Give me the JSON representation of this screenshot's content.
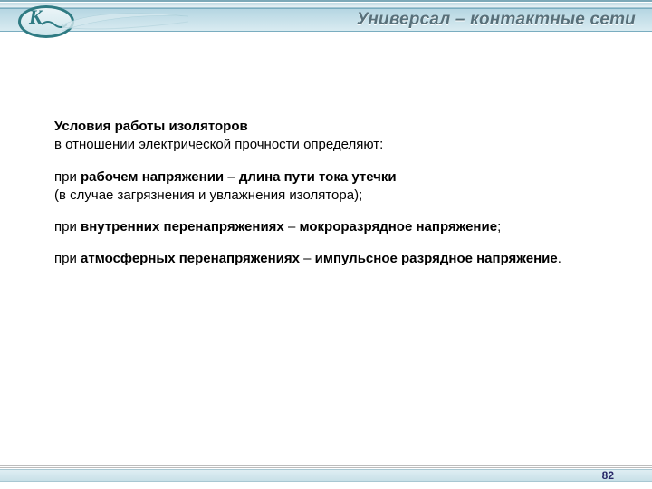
{
  "header": {
    "title": "Универсал – контактные сети",
    "logo_letter": "К"
  },
  "content": {
    "intro_line1": "Условия работы изоляторов",
    "intro_line2": "в отношении электрической прочности определяют:",
    "items": [
      {
        "prefix": "при ",
        "condition": "рабочем напряжении",
        "dash": " – ",
        "term": "длина пути тока утечки",
        "suffix_line": "(в случае загрязнения и увлажнения изолятора);"
      },
      {
        "prefix": "при ",
        "condition": "внутренних перенапряжениях",
        "dash": " – ",
        "term": "мокроразрядное напряжение",
        "tail": ";"
      },
      {
        "prefix": "при ",
        "condition": "атмосферных перенапряжениях",
        "dash": " – ",
        "term": "импульсное разрядное напряжение",
        "tail": "."
      }
    ]
  },
  "footer": {
    "page": "82"
  }
}
